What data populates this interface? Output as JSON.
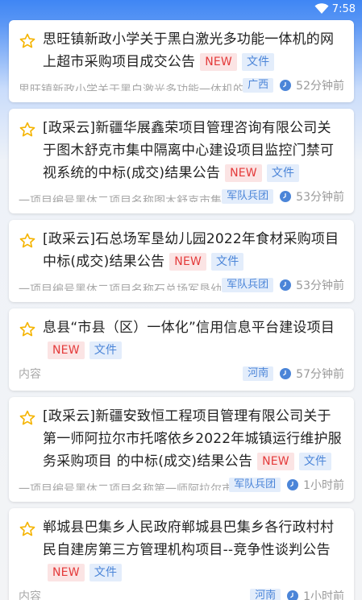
{
  "status_bar": {
    "time": "7:58"
  },
  "items": [
    {
      "title": "思旺镇新政小学关于黑白激光多功能一体机的网上超市采购项目成交公告",
      "new_label": "NEW",
      "file_label": "文件",
      "summary": "思旺镇新政小学关于黑白激光多功能一体机的",
      "region": "广西",
      "time_ago": "52分钟前"
    },
    {
      "title": "[政采云]新疆华展鑫荣项目管理咨询有限公司关于图木舒克市集中隔离中心建设项目监控门禁可视系统的中标(成交)结果公告",
      "new_label": "NEW",
      "file_label": "文件",
      "summary": "一项目编号黑体二项目名称图木舒克市集中",
      "region": "军队兵团",
      "time_ago": "53分钟前"
    },
    {
      "title": "[政采云]石总场军垦幼儿园2022年食材采购项目中标(成交)结果公告",
      "new_label": "NEW",
      "file_label": "文件",
      "summary": "一项目编号黑体二项目名称石总场军垦幼儿",
      "region": "军队兵团",
      "time_ago": "53分钟前"
    },
    {
      "title": "息县“市县（区）一体化”信用信息平台建设项目",
      "new_label": "NEW",
      "file_label": "文件",
      "summary": "内容",
      "region": "河南",
      "time_ago": "57分钟前"
    },
    {
      "title": "[政采云]新疆安致恒工程项目管理有限公司关于第一师阿拉尔市托喀依乡2022年城镇运行维护服务采购项目 的中标(成交)结果公告",
      "new_label": "NEW",
      "file_label": "文件",
      "summary": "一项目编号黑体二项目名称第一师阿拉尔市",
      "region": "军队兵团",
      "time_ago": "1小时前"
    },
    {
      "title": "郸城县巴集乡人民政府郸城县巴集乡各行政村村民自建房第三方管理机构项目--竞争性谈判公告",
      "new_label": "NEW",
      "file_label": "文件",
      "summary": "内容",
      "region": "河南",
      "time_ago": "1小时前"
    }
  ],
  "colors": {
    "accent": "#3f86f4",
    "star": "#f5b400",
    "new_bg": "#fbe4e4",
    "new_text": "#e43a3a",
    "tag_bg": "#e3edfb",
    "tag_text": "#4b85d8"
  },
  "icons": {
    "status": [
      "wifi-icon"
    ],
    "item": [
      "star-outline-icon",
      "clock-icon"
    ]
  }
}
